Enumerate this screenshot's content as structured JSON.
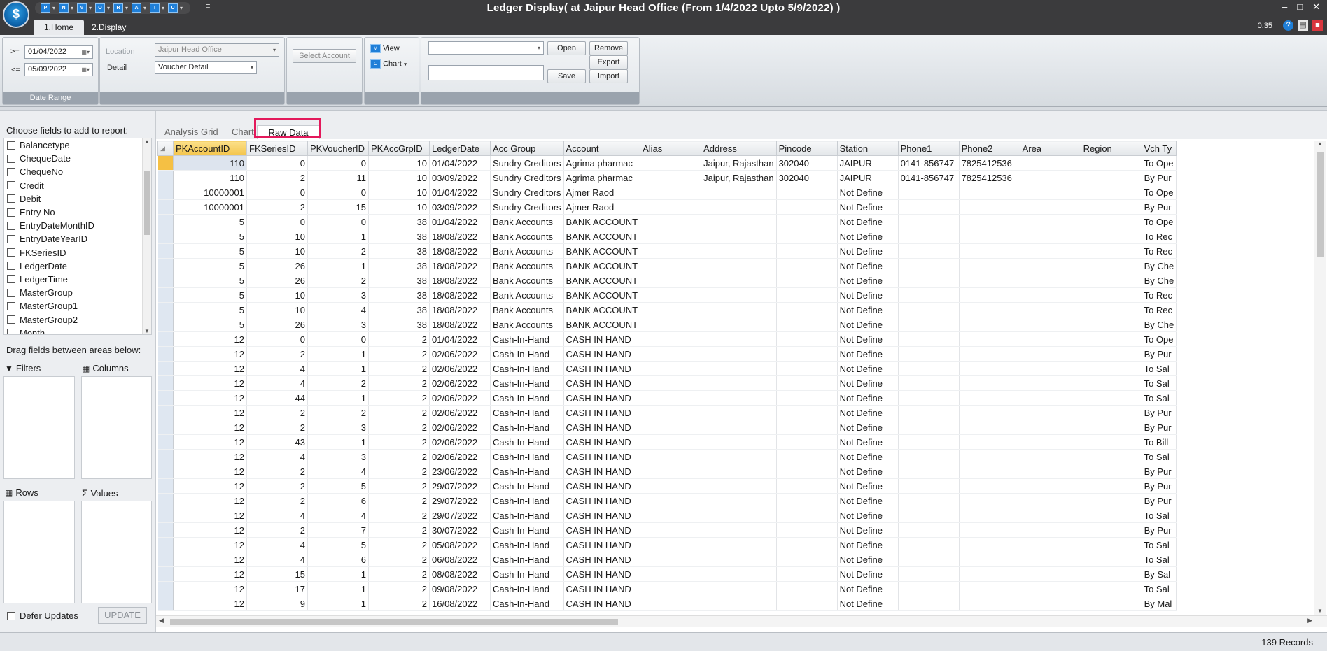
{
  "window": {
    "title": "Ledger Display( at Jaipur Head Office  (From 1/4/2022 Upto 5/9/2022) )",
    "min_label": "–",
    "max_label": "□",
    "close_label": "✕"
  },
  "app_icon_label": "$",
  "qat": [
    "P",
    "N",
    "V",
    "O",
    "R",
    "A",
    "T",
    "U"
  ],
  "ribbon_tabs": [
    "1.Home",
    "2.Display"
  ],
  "zoom": "0.35",
  "date_range": {
    "ge_label": ">=",
    "le_label": "<=",
    "from": "01/04/2022",
    "to": "05/09/2022",
    "group_label": "Date Range"
  },
  "location": {
    "label": "Location",
    "value": "Jaipur Head Office",
    "detail_label": "Detail",
    "detail_value": "Voucher Detail"
  },
  "select_account_label": "Select Account",
  "view_label": "View",
  "chart_label": "Chart",
  "layout": {
    "combo_value": "",
    "text_value": "",
    "open": "Open",
    "remove": "Remove",
    "export": "Export",
    "save": "Save",
    "import": "Import"
  },
  "left": {
    "choose_label": "Choose fields to add to report:",
    "fields": [
      "Balancetype",
      "ChequeDate",
      "ChequeNo",
      "Credit",
      "Debit",
      "Entry No",
      "EntryDateMonthID",
      "EntryDateYearID",
      "FKSeriesID",
      "LedgerDate",
      "LedgerTime",
      "MasterGroup",
      "MasterGroup1",
      "MasterGroup2",
      "Month"
    ],
    "drag_label": "Drag fields between areas below:",
    "filters": "Filters",
    "columns": "Columns",
    "rows": "Rows",
    "values": "Values",
    "defer": "Defer Updates",
    "update": "UPDATE"
  },
  "grid_tabs": [
    "Analysis Grid",
    "Chart",
    "Raw Data"
  ],
  "columns": [
    "PKAccountID",
    "FKSeriesID",
    "PKVoucherID",
    "PKAccGrpID",
    "LedgerDate",
    "Acc Group",
    "Account",
    "Alias",
    "Address",
    "Pincode",
    "Station",
    "Phone1",
    "Phone2",
    "Area",
    "Region",
    "Vch Ty"
  ],
  "rows": [
    [
      "110",
      "0",
      "0",
      "10",
      "01/04/2022",
      "Sundry Creditors",
      "Agrima pharmac",
      "",
      "Jaipur, Rajasthan",
      "302040",
      "JAIPUR",
      "0141-856747",
      "7825412536",
      "",
      "",
      "To Ope"
    ],
    [
      "110",
      "2",
      "11",
      "10",
      "03/09/2022",
      "Sundry Creditors",
      "Agrima pharmac",
      "",
      "Jaipur, Rajasthan",
      "302040",
      "JAIPUR",
      "0141-856747",
      "7825412536",
      "",
      "",
      "By Pur"
    ],
    [
      "10000001",
      "0",
      "0",
      "10",
      "01/04/2022",
      "Sundry Creditors",
      "Ajmer Raod",
      "",
      "",
      "",
      "Not Define",
      "",
      "",
      "",
      "",
      "To Ope"
    ],
    [
      "10000001",
      "2",
      "15",
      "10",
      "03/09/2022",
      "Sundry Creditors",
      "Ajmer Raod",
      "",
      "",
      "",
      "Not Define",
      "",
      "",
      "",
      "",
      "By Pur"
    ],
    [
      "5",
      "0",
      "0",
      "38",
      "01/04/2022",
      "Bank Accounts",
      "BANK ACCOUNT",
      "",
      "",
      "",
      "Not Define",
      "",
      "",
      "",
      "",
      "To Ope"
    ],
    [
      "5",
      "10",
      "1",
      "38",
      "18/08/2022",
      "Bank Accounts",
      "BANK ACCOUNT",
      "",
      "",
      "",
      "Not Define",
      "",
      "",
      "",
      "",
      "To Rec"
    ],
    [
      "5",
      "10",
      "2",
      "38",
      "18/08/2022",
      "Bank Accounts",
      "BANK ACCOUNT",
      "",
      "",
      "",
      "Not Define",
      "",
      "",
      "",
      "",
      "To Rec"
    ],
    [
      "5",
      "26",
      "1",
      "38",
      "18/08/2022",
      "Bank Accounts",
      "BANK ACCOUNT",
      "",
      "",
      "",
      "Not Define",
      "",
      "",
      "",
      "",
      "By Che"
    ],
    [
      "5",
      "26",
      "2",
      "38",
      "18/08/2022",
      "Bank Accounts",
      "BANK ACCOUNT",
      "",
      "",
      "",
      "Not Define",
      "",
      "",
      "",
      "",
      "By Che"
    ],
    [
      "5",
      "10",
      "3",
      "38",
      "18/08/2022",
      "Bank Accounts",
      "BANK ACCOUNT",
      "",
      "",
      "",
      "Not Define",
      "",
      "",
      "",
      "",
      "To Rec"
    ],
    [
      "5",
      "10",
      "4",
      "38",
      "18/08/2022",
      "Bank Accounts",
      "BANK ACCOUNT",
      "",
      "",
      "",
      "Not Define",
      "",
      "",
      "",
      "",
      "To Rec"
    ],
    [
      "5",
      "26",
      "3",
      "38",
      "18/08/2022",
      "Bank Accounts",
      "BANK ACCOUNT",
      "",
      "",
      "",
      "Not Define",
      "",
      "",
      "",
      "",
      "By Che"
    ],
    [
      "12",
      "0",
      "0",
      "2",
      "01/04/2022",
      "Cash-In-Hand",
      "CASH IN HAND",
      "",
      "",
      "",
      "Not Define",
      "",
      "",
      "",
      "",
      "To Ope"
    ],
    [
      "12",
      "2",
      "1",
      "2",
      "02/06/2022",
      "Cash-In-Hand",
      "CASH IN HAND",
      "",
      "",
      "",
      "Not Define",
      "",
      "",
      "",
      "",
      "By Pur"
    ],
    [
      "12",
      "4",
      "1",
      "2",
      "02/06/2022",
      "Cash-In-Hand",
      "CASH IN HAND",
      "",
      "",
      "",
      "Not Define",
      "",
      "",
      "",
      "",
      "To Sal"
    ],
    [
      "12",
      "4",
      "2",
      "2",
      "02/06/2022",
      "Cash-In-Hand",
      "CASH IN HAND",
      "",
      "",
      "",
      "Not Define",
      "",
      "",
      "",
      "",
      "To Sal"
    ],
    [
      "12",
      "44",
      "1",
      "2",
      "02/06/2022",
      "Cash-In-Hand",
      "CASH IN HAND",
      "",
      "",
      "",
      "Not Define",
      "",
      "",
      "",
      "",
      "To Sal"
    ],
    [
      "12",
      "2",
      "2",
      "2",
      "02/06/2022",
      "Cash-In-Hand",
      "CASH IN HAND",
      "",
      "",
      "",
      "Not Define",
      "",
      "",
      "",
      "",
      "By Pur"
    ],
    [
      "12",
      "2",
      "3",
      "2",
      "02/06/2022",
      "Cash-In-Hand",
      "CASH IN HAND",
      "",
      "",
      "",
      "Not Define",
      "",
      "",
      "",
      "",
      "By Pur"
    ],
    [
      "12",
      "43",
      "1",
      "2",
      "02/06/2022",
      "Cash-In-Hand",
      "CASH IN HAND",
      "",
      "",
      "",
      "Not Define",
      "",
      "",
      "",
      "",
      "To Bill"
    ],
    [
      "12",
      "4",
      "3",
      "2",
      "02/06/2022",
      "Cash-In-Hand",
      "CASH IN HAND",
      "",
      "",
      "",
      "Not Define",
      "",
      "",
      "",
      "",
      "To Sal"
    ],
    [
      "12",
      "2",
      "4",
      "2",
      "23/06/2022",
      "Cash-In-Hand",
      "CASH IN HAND",
      "",
      "",
      "",
      "Not Define",
      "",
      "",
      "",
      "",
      "By Pur"
    ],
    [
      "12",
      "2",
      "5",
      "2",
      "29/07/2022",
      "Cash-In-Hand",
      "CASH IN HAND",
      "",
      "",
      "",
      "Not Define",
      "",
      "",
      "",
      "",
      "By Pur"
    ],
    [
      "12",
      "2",
      "6",
      "2",
      "29/07/2022",
      "Cash-In-Hand",
      "CASH IN HAND",
      "",
      "",
      "",
      "Not Define",
      "",
      "",
      "",
      "",
      "By Pur"
    ],
    [
      "12",
      "4",
      "4",
      "2",
      "29/07/2022",
      "Cash-In-Hand",
      "CASH IN HAND",
      "",
      "",
      "",
      "Not Define",
      "",
      "",
      "",
      "",
      "To Sal"
    ],
    [
      "12",
      "2",
      "7",
      "2",
      "30/07/2022",
      "Cash-In-Hand",
      "CASH IN HAND",
      "",
      "",
      "",
      "Not Define",
      "",
      "",
      "",
      "",
      "By Pur"
    ],
    [
      "12",
      "4",
      "5",
      "2",
      "05/08/2022",
      "Cash-In-Hand",
      "CASH IN HAND",
      "",
      "",
      "",
      "Not Define",
      "",
      "",
      "",
      "",
      "To Sal"
    ],
    [
      "12",
      "4",
      "6",
      "2",
      "06/08/2022",
      "Cash-In-Hand",
      "CASH IN HAND",
      "",
      "",
      "",
      "Not Define",
      "",
      "",
      "",
      "",
      "To Sal"
    ],
    [
      "12",
      "15",
      "1",
      "2",
      "08/08/2022",
      "Cash-In-Hand",
      "CASH IN HAND",
      "",
      "",
      "",
      "Not Define",
      "",
      "",
      "",
      "",
      "By Sal"
    ],
    [
      "12",
      "17",
      "1",
      "2",
      "09/08/2022",
      "Cash-In-Hand",
      "CASH IN HAND",
      "",
      "",
      "",
      "Not Define",
      "",
      "",
      "",
      "",
      "To Sal"
    ],
    [
      "12",
      "9",
      "1",
      "2",
      "16/08/2022",
      "Cash-In-Hand",
      "CASH IN HAND",
      "",
      "",
      "",
      "Not Define",
      "",
      "",
      "",
      "",
      "By Mal"
    ]
  ],
  "status": {
    "records": "139 Records"
  },
  "colors": {
    "highlight": "#e3195b",
    "selected_header": "#f3c44b",
    "titlebar": "#3b3b3d"
  }
}
